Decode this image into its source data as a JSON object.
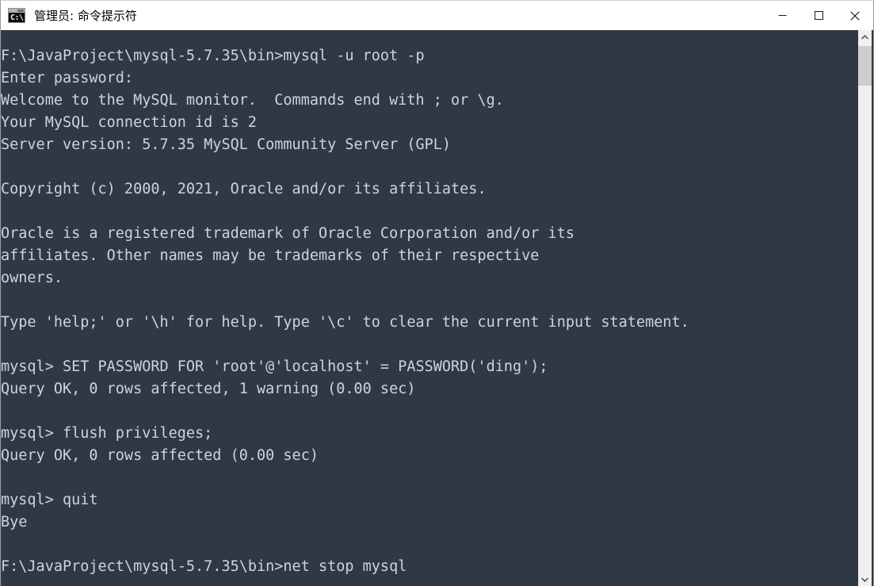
{
  "window": {
    "title": "管理员: 命令提示符",
    "icon_name": "cmd-console-icon",
    "icon_prompt": "C:\\",
    "colors": {
      "titlebar_bg": "#ffffff",
      "titlebar_fg": "#000000",
      "console_bg": "#2f3843",
      "console_fg": "#ccd4e1",
      "scrollbar_track": "#f0f0f0",
      "scrollbar_thumb": "#cdcdcd",
      "close_hover": "#e81123"
    },
    "controls": [
      {
        "name": "minimize-button",
        "glyph": "minimize"
      },
      {
        "name": "maximize-button",
        "glyph": "maximize"
      },
      {
        "name": "close-button",
        "glyph": "close"
      }
    ]
  },
  "scrollbar": {
    "up_arrow": "scroll-up-arrow-icon",
    "down_arrow": "scroll-down-arrow-icon",
    "thumb": "scrollbar-thumb"
  },
  "console": {
    "lines": [
      "F:\\JavaProject\\mysql-5.7.35\\bin>mysql -u root -p",
      "Enter password:",
      "Welcome to the MySQL monitor.  Commands end with ; or \\g.",
      "Your MySQL connection id is 2",
      "Server version: 5.7.35 MySQL Community Server (GPL)",
      "",
      "Copyright (c) 2000, 2021, Oracle and/or its affiliates.",
      "",
      "Oracle is a registered trademark of Oracle Corporation and/or its",
      "affiliates. Other names may be trademarks of their respective",
      "owners.",
      "",
      "Type 'help;' or '\\h' for help. Type '\\c' to clear the current input statement.",
      "",
      "mysql> SET PASSWORD FOR 'root'@'localhost' = PASSWORD('ding');",
      "Query OK, 0 rows affected, 1 warning (0.00 sec)",
      "",
      "mysql> flush privileges;",
      "Query OK, 0 rows affected (0.00 sec)",
      "",
      "mysql> quit",
      "Bye",
      "",
      "F:\\JavaProject\\mysql-5.7.35\\bin>net stop mysql"
    ]
  }
}
